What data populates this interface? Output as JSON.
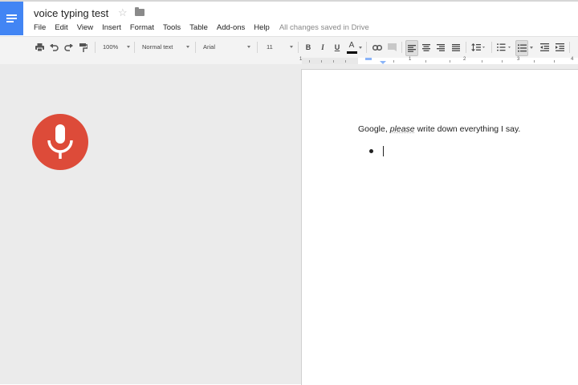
{
  "header": {
    "title": "voice typing test",
    "menu": [
      "File",
      "Edit",
      "View",
      "Insert",
      "Format",
      "Tools",
      "Table",
      "Add-ons",
      "Help"
    ],
    "save_status": "All changes saved in Drive"
  },
  "toolbar": {
    "zoom": "100%",
    "style": "Normal text",
    "font": "Arial",
    "size": "11",
    "bold": "B",
    "italic": "I",
    "underline": "U",
    "text_color_label": "A"
  },
  "ruler": {
    "numbers": [
      "1",
      "1",
      "2",
      "3",
      "4"
    ]
  },
  "document": {
    "line_before": "Google, ",
    "line_emphasis": "please",
    "line_after": " write down everything I say."
  },
  "colors": {
    "docs_blue": "#4285f4",
    "mic_red": "#dd4b39",
    "text_color_bar": "#000000"
  },
  "icons": [
    "docs-menu-icon",
    "star-icon",
    "folder-icon",
    "print-icon",
    "undo-icon",
    "redo-icon",
    "paint-format-icon",
    "link-icon",
    "comment-icon",
    "align-left-icon",
    "align-center-icon",
    "align-right-icon",
    "justify-icon",
    "line-spacing-icon",
    "numbered-list-icon",
    "bulleted-list-icon",
    "decrease-indent-icon",
    "increase-indent-icon",
    "microphone-icon"
  ]
}
